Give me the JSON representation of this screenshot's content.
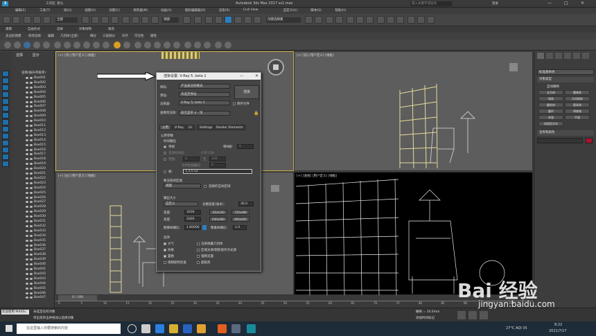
{
  "window": {
    "title": "Autodesk 3ds Max 2017    ss1.max",
    "workspace": "工作区: 默认",
    "search_placeholder": "键入关键字或短语",
    "login": "登录"
  },
  "menu": [
    "编辑(E)",
    "工具(T)",
    "组(G)",
    "视图(V)",
    "创建(C)",
    "修改器(M)",
    "动画(A)",
    "图形编辑器(D)",
    "渲染(R)",
    "Civil View",
    "自定义(U)",
    "脚本(S)",
    "帮助(H)"
  ],
  "toolbar": {
    "selection_set": "创建选择集",
    "view_dropdown": "视图"
  },
  "ribbon": [
    "建模",
    "自由形式",
    "选择",
    "对象绘制",
    "填充"
  ],
  "ribbon_sub": [
    "多边形建模",
    "修改选择",
    "编辑",
    "几何体(全部)",
    "细分",
    "三角剖分",
    "对齐",
    "可见性",
    "属性"
  ],
  "ribbon_sub2": [
    "多边形建模"
  ],
  "scene_explorer": {
    "tabs": [
      "选择",
      "显示"
    ],
    "header": "名称(按升序排序)",
    "items": [
      "Box001",
      "Box002",
      "Box003",
      "Box004",
      "Box005",
      "Box006",
      "Box007",
      "Box008",
      "Box009",
      "Box010",
      "Box011",
      "Box012",
      "Box013",
      "Box014",
      "Box015",
      "Box016",
      "Box017",
      "Box018",
      "Box019",
      "Box020",
      "Box021",
      "Box022",
      "Box023",
      "Box024",
      "Box025",
      "Box026",
      "Box027",
      "Box028",
      "Box029",
      "Box030",
      "Box031",
      "Box032",
      "Box033",
      "Box034",
      "Box035",
      "Box036",
      "Box037",
      "Box038",
      "Box039",
      "Box040",
      "Box041",
      "Box042",
      "Box043",
      "Box044",
      "Box045",
      "Box046",
      "Box047"
    ]
  },
  "viewports": {
    "top": "[+] [顶] [用户定义] [线框]",
    "front": "[+] [前] [用户定义] [线框]",
    "left": "[+] [左] [用户定义] [线框]",
    "persp": "[+] [透视] [用户定义] [线框]"
  },
  "dialog": {
    "title": "渲染设置: V-Ray 5, beta 1",
    "target_label": "目标:",
    "target_value": "产品级渲染模式",
    "preset_label": "预设:",
    "preset_value": "未选定预设",
    "renderer_label": "渲染器:",
    "renderer_value": "V-Ray 5, beta 1",
    "save_file": "保存文件",
    "view_label": "查看到渲染:",
    "view_value": "四元菜单 4 - 顶",
    "render_button": "渲染",
    "tabs": [
      "公用",
      "V-Ray",
      "GI",
      "Settings",
      "Render Elements"
    ],
    "rollout_common": "公用参数",
    "time_output": "时间输出",
    "single": "单帧",
    "every_n": "每N帧:",
    "every_n_val": "1",
    "active_segment": "活动时间段:",
    "active_segment_val": "0 到 100",
    "range": "范围:",
    "range_from": "0",
    "range_to": "至",
    "range_to_val": "100",
    "file_start": "文件起始编号:",
    "file_start_val": "0",
    "frames": "帧:",
    "frames_val": "1,3,5-12",
    "area_label": "要渲染的区域",
    "area_value": "视图",
    "auto_region": "选择的自动区域",
    "output_size": "输出大小",
    "output_value": "自定义",
    "aperture": "光圈宽度(毫米):",
    "aperture_val": "36.0",
    "width_label": "宽度:",
    "width_val": "3200",
    "height_label": "高度:",
    "height_val": "2000",
    "res": [
      "320x240",
      "720x486",
      "640x480",
      "800x600"
    ],
    "aspect_label": "图像纵横比:",
    "aspect_val": "1.60000",
    "pixel_aspect": "像素纵横比:",
    "pixel_aspect_val": "1.0",
    "options": "选项",
    "opt_atmos": "大气",
    "opt_effects": "效果",
    "opt_displace": "置换",
    "opt_video": "视频颜色检查",
    "opt_hidden": "渲染隐藏几何体",
    "opt_area": "区域光源/阴影视作点光源",
    "opt_force2": "强制双面",
    "opt_super": "超级黑"
  },
  "cmd_panel": {
    "dropdown": "标准基本体",
    "rollout_type": "对象类型",
    "autogrid": "自动栅格",
    "objects": [
      "长方体",
      "圆锥体",
      "球体",
      "几何球体",
      "圆柱体",
      "管状体",
      "圆环",
      "四棱锥",
      "茶壶",
      "平面",
      "加强型文本"
    ],
    "rollout_name": "名称和颜色",
    "color": "#b01030"
  },
  "timeline": {
    "frame": "0 / 100",
    "ticks": [
      "0",
      "5",
      "10",
      "15",
      "20",
      "25",
      "30",
      "35",
      "40",
      "45",
      "50",
      "55",
      "60",
      "65",
      "70",
      "75",
      "80",
      "85",
      "90",
      "95",
      "100"
    ]
  },
  "status": {
    "welcome": "欢迎使用 MAXSc",
    "msg1": "未选定任何对象",
    "msg2": "单击或单击并拖动以选择对象",
    "grid": "栅格 = 10.0mm",
    "add_time_tag": "添加时间标记"
  },
  "taskbar": {
    "search": "在这里输入你要搜索的内容",
    "weather": "27°C AQI 35",
    "time": "8:22",
    "date": "2021/7/17"
  },
  "watermark": {
    "brand": "Bai 经验",
    "url": "jingyan.baidu.com"
  }
}
